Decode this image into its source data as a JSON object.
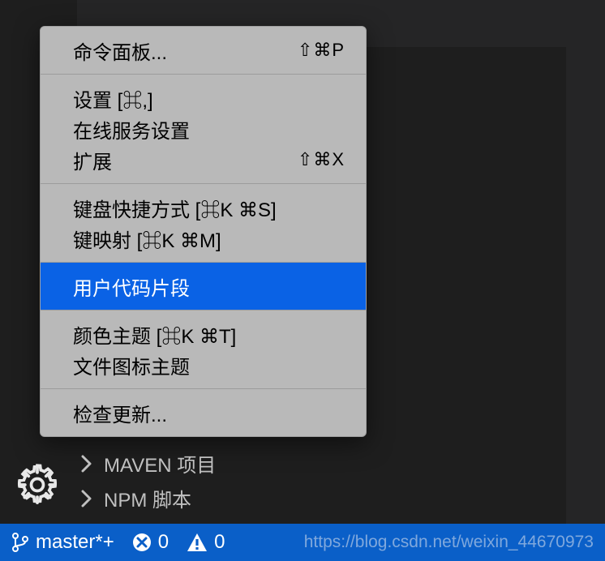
{
  "menu": {
    "groups": [
      {
        "items": [
          {
            "label": "命令面板...",
            "shortcut": "⇧⌘P",
            "highlight": false
          }
        ]
      },
      {
        "items": [
          {
            "label": "设置 [⌘,]",
            "shortcut": "",
            "highlight": false
          },
          {
            "label": "在线服务设置",
            "shortcut": "",
            "highlight": false
          },
          {
            "label": "扩展",
            "shortcut": "⇧⌘X",
            "highlight": false
          }
        ]
      },
      {
        "items": [
          {
            "label": "键盘快捷方式 [⌘K ⌘S]",
            "shortcut": "",
            "highlight": false
          },
          {
            "label": "键映射 [⌘K ⌘M]",
            "shortcut": "",
            "highlight": false
          }
        ]
      },
      {
        "items": [
          {
            "label": "用户代码片段",
            "shortcut": "",
            "highlight": true
          }
        ]
      },
      {
        "items": [
          {
            "label": "颜色主题 [⌘K ⌘T]",
            "shortcut": "",
            "highlight": false
          },
          {
            "label": "文件图标主题",
            "shortcut": "",
            "highlight": false
          }
        ]
      },
      {
        "items": [
          {
            "label": "检查更新...",
            "shortcut": "",
            "highlight": false
          }
        ]
      }
    ]
  },
  "sections": {
    "maven": "MAVEN 项目",
    "npm": "NPM 脚本"
  },
  "statusbar": {
    "branch": "master*+",
    "errors": "0",
    "warnings": "0"
  },
  "watermark": "https://blog.csdn.net/weixin_44670973"
}
